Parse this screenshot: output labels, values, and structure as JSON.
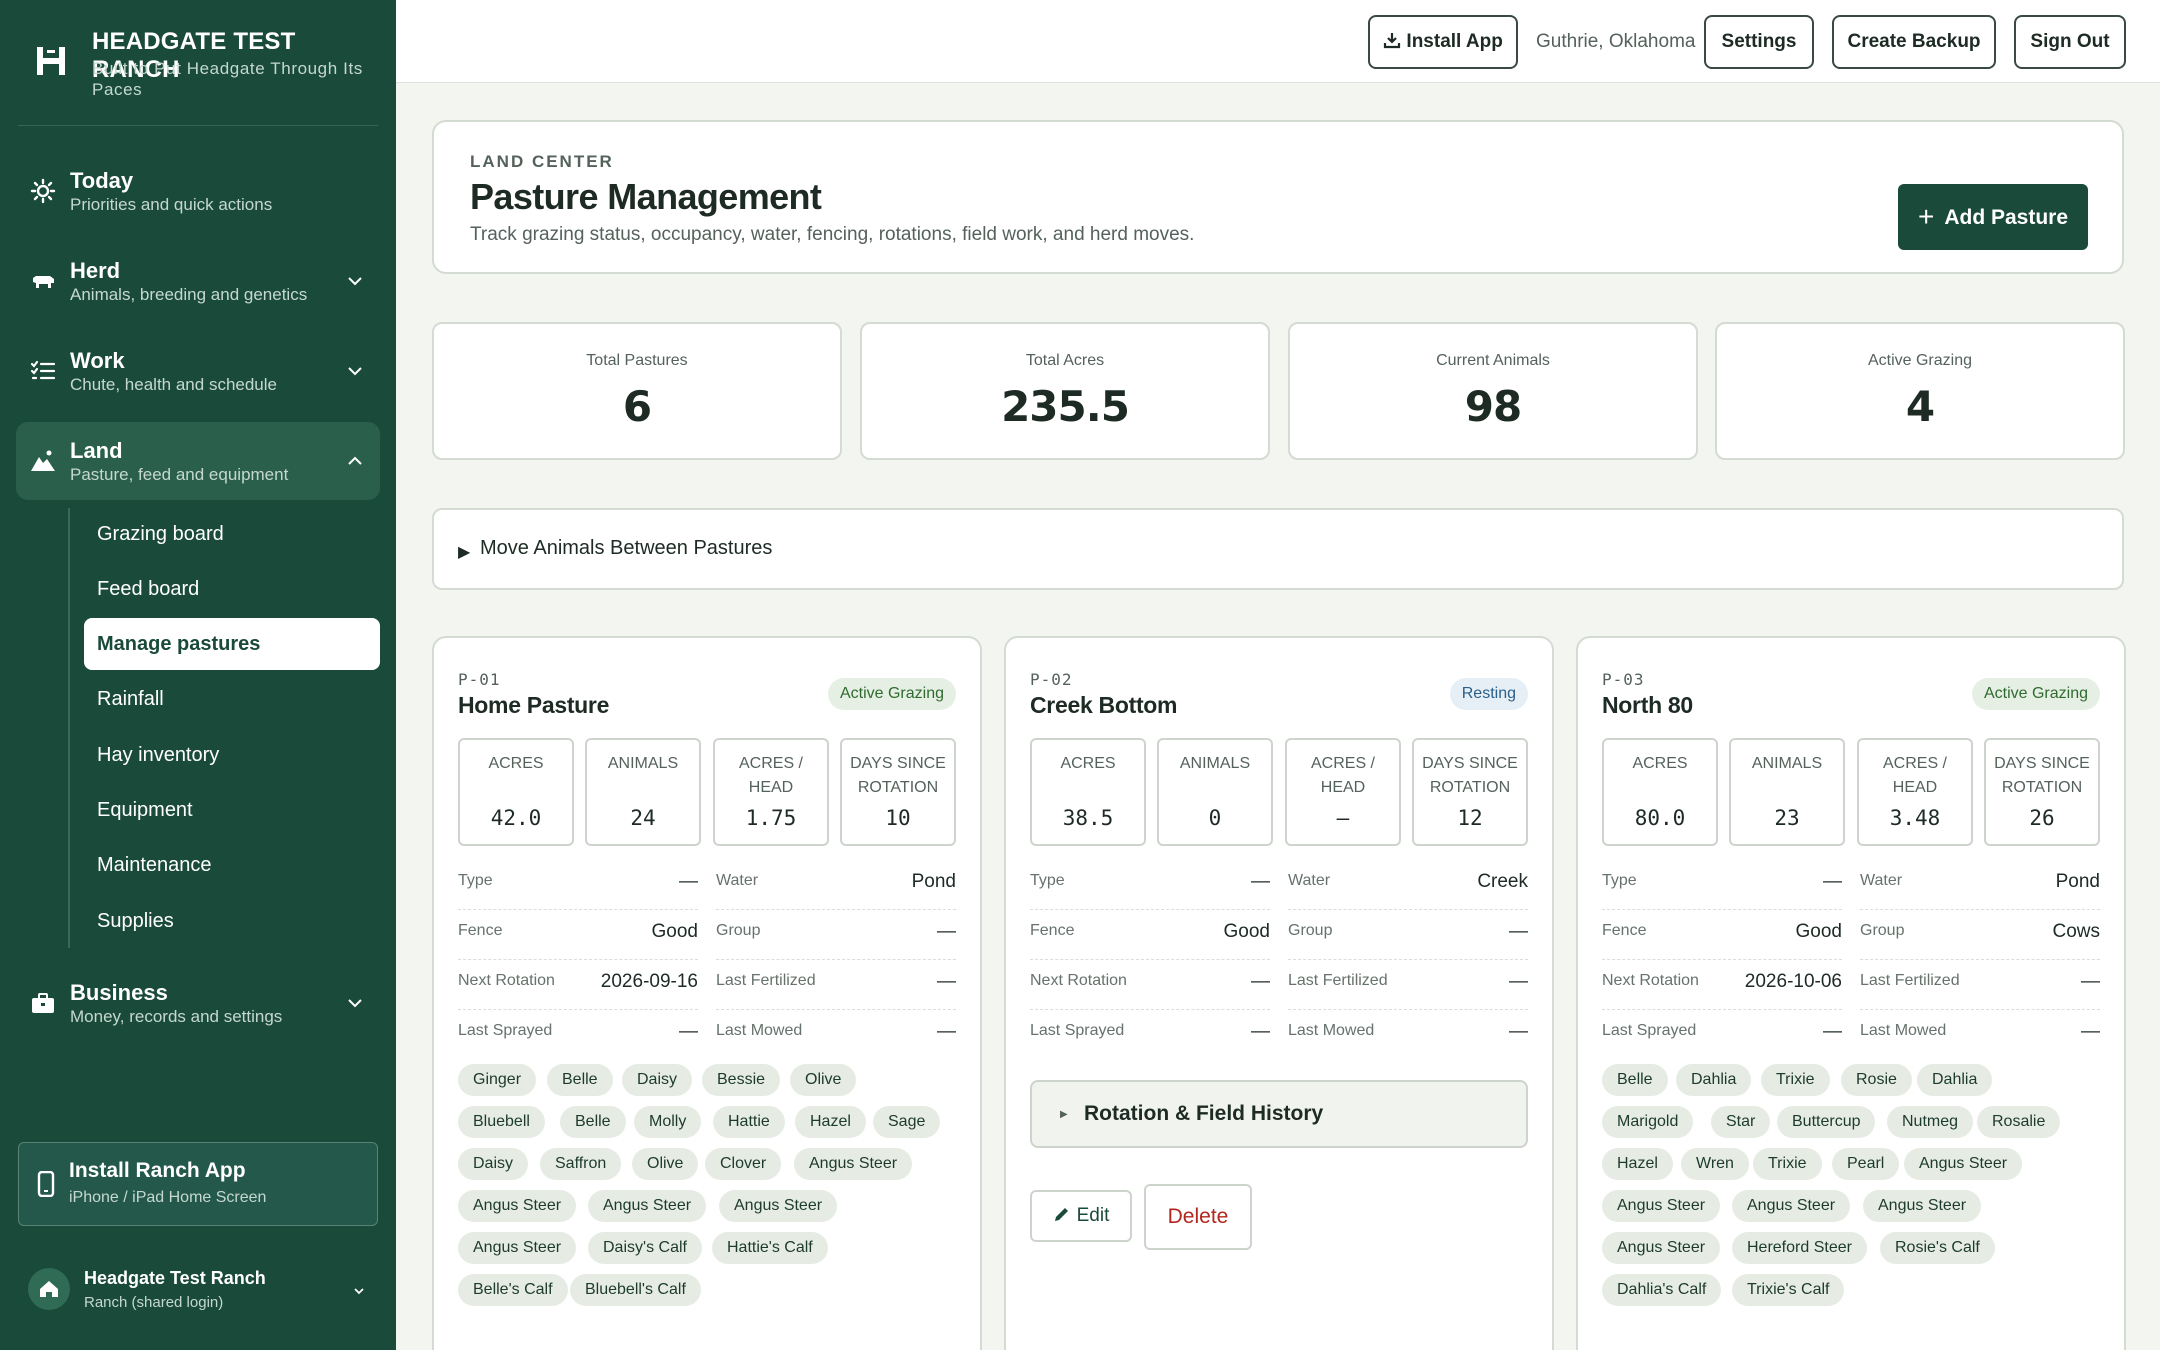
{
  "brand": {
    "title": "HEADGATE TEST RANCH",
    "subtitle": "Built to Put Headgate Through Its Paces"
  },
  "nav": [
    {
      "title": "Today",
      "sub": "Priorities and quick actions"
    },
    {
      "title": "Herd",
      "sub": "Animals, breeding and genetics"
    },
    {
      "title": "Work",
      "sub": "Chute, health and schedule"
    },
    {
      "title": "Land",
      "sub": "Pasture, feed and equipment"
    },
    {
      "title": "Business",
      "sub": "Money, records and settings"
    }
  ],
  "subnav": [
    "Grazing board",
    "Feed board",
    "Manage pastures",
    "Rainfall",
    "Hay inventory",
    "Equipment",
    "Maintenance",
    "Supplies"
  ],
  "install_card": {
    "title": "Install Ranch App",
    "sub": "iPhone / iPad Home Screen"
  },
  "account": {
    "name": "Headgate Test Ranch",
    "role": "Ranch (shared login)"
  },
  "topbar": {
    "install": "Install App",
    "location": "Guthrie, Oklahoma",
    "settings": "Settings",
    "backup": "Create Backup",
    "signout": "Sign Out"
  },
  "header": {
    "eyebrow": "LAND CENTER",
    "title": "Pasture Management",
    "subtitle": "Track grazing status, occupancy, water, fencing, rotations, field work, and herd moves.",
    "add_button": "Add Pasture"
  },
  "stats": [
    {
      "label": "Total Pastures",
      "value": "6"
    },
    {
      "label": "Total Acres",
      "value": "235.5"
    },
    {
      "label": "Current Animals",
      "value": "98"
    },
    {
      "label": "Active Grazing",
      "value": "4"
    }
  ],
  "move": {
    "label": "Move Animals Between Pastures"
  },
  "metric_labels": {
    "acres": "ACRES",
    "animals": "ANIMALS",
    "acres_head": "ACRES / HEAD",
    "days": "DAYS SINCE ROTATION"
  },
  "detail_labels": {
    "type": "Type",
    "water": "Water",
    "fence": "Fence",
    "group": "Group",
    "next_rotation": "Next Rotation",
    "last_fertilized": "Last Fertilized",
    "last_sprayed": "Last Sprayed",
    "last_mowed": "Last Mowed"
  },
  "pastures": [
    {
      "code": "P-01",
      "name": "Home Pasture",
      "status": "Active Grazing",
      "acres": "42.0",
      "animals": "24",
      "acres_head": "1.75",
      "days": "10",
      "type": "—",
      "water": "Pond",
      "fence": "Good",
      "group": "—",
      "next_rotation": "2026-09-16",
      "last_fertilized": "—",
      "last_sprayed": "—",
      "last_mowed": "—",
      "tags": [
        "Ginger",
        "Belle",
        "Daisy",
        "Bessie",
        "Olive",
        "Bluebell",
        "Belle",
        "Molly",
        "Hattie",
        "Hazel",
        "Sage",
        "Daisy",
        "Saffron",
        "Olive",
        "Clover",
        "Angus Steer",
        "Angus Steer",
        "Angus Steer",
        "Angus Steer",
        "Angus Steer",
        "Daisy's Calf",
        "Hattie's Calf",
        "Belle's Calf",
        "Bluebell's Calf"
      ]
    },
    {
      "code": "P-02",
      "name": "Creek Bottom",
      "status": "Resting",
      "acres": "38.5",
      "animals": "0",
      "acres_head": "—",
      "days": "12",
      "type": "—",
      "water": "Creek",
      "fence": "Good",
      "group": "—",
      "next_rotation": "—",
      "last_fertilized": "—",
      "last_sprayed": "—",
      "last_mowed": "—",
      "history": "Rotation & Field History",
      "edit": "Edit",
      "delete": "Delete"
    },
    {
      "code": "P-03",
      "name": "North 80",
      "status": "Active Grazing",
      "acres": "80.0",
      "animals": "23",
      "acres_head": "3.48",
      "days": "26",
      "type": "—",
      "water": "Pond",
      "fence": "Good",
      "group": "Cows",
      "next_rotation": "2026-10-06",
      "last_fertilized": "—",
      "last_sprayed": "—",
      "last_mowed": "—",
      "tags": [
        "Belle",
        "Dahlia",
        "Trixie",
        "Rosie",
        "Dahlia",
        "Marigold",
        "Star",
        "Buttercup",
        "Nutmeg",
        "Rosalie",
        "Hazel",
        "Wren",
        "Trixie",
        "Pearl",
        "Angus Steer",
        "Angus Steer",
        "Angus Steer",
        "Angus Steer",
        "Angus Steer",
        "Hereford Steer",
        "Rosie's Calf",
        "Dahlia's Calf",
        "Trixie's Calf"
      ]
    }
  ]
}
